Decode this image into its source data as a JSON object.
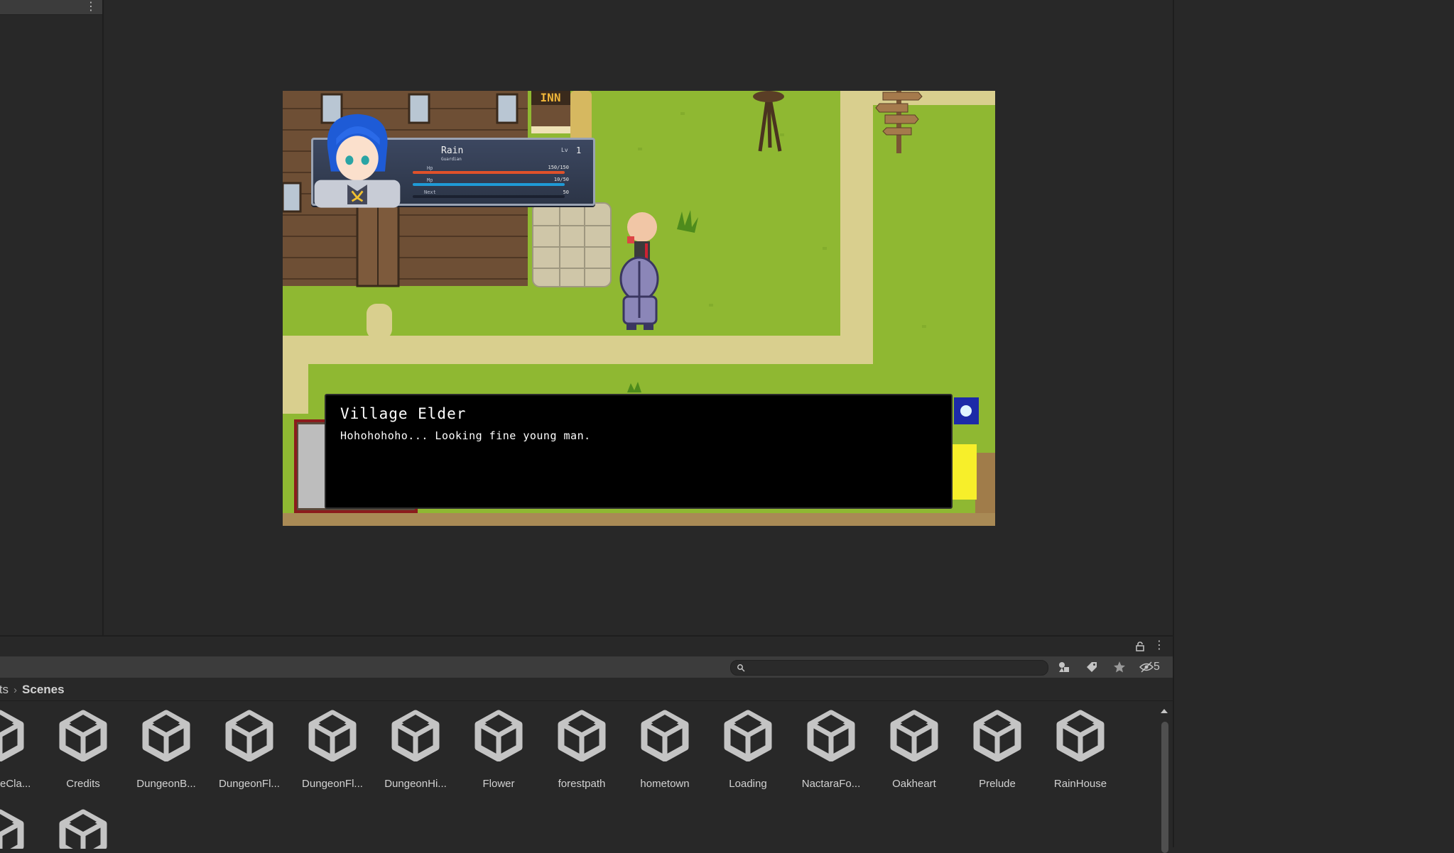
{
  "project": {
    "breadcrumb": [
      "Assets",
      "Scenes"
    ],
    "search_placeholder": "",
    "hidden_count": "5",
    "assets": [
      {
        "label": "ChooseCla..."
      },
      {
        "label": "Credits"
      },
      {
        "label": "DungeonB..."
      },
      {
        "label": "DungeonFl..."
      },
      {
        "label": "DungeonFl..."
      },
      {
        "label": "DungeonHi..."
      },
      {
        "label": "Flower"
      },
      {
        "label": "forestpath"
      },
      {
        "label": "hometown"
      },
      {
        "label": "Loading"
      },
      {
        "label": "NactaraFo..."
      },
      {
        "label": "Oakheart"
      },
      {
        "label": "Prelude"
      },
      {
        "label": "RainHouse"
      },
      {
        "label": ""
      },
      {
        "label": ""
      }
    ]
  },
  "game": {
    "inn_sign": "INN",
    "hud": {
      "name": "Rain",
      "class": "Guardian",
      "level_label": "Lv",
      "level": "1",
      "hp_label": "Hp",
      "hp_value": "150/150",
      "hp_fraction": 1.0,
      "mp_label": "Mp",
      "mp_value": "10/50",
      "mp_fraction": 1.0,
      "next_label": "Next",
      "next_value": "50",
      "next_fraction": 0.0
    },
    "dialog": {
      "speaker": "Village Elder",
      "text": "Hohohohoho... Looking fine young man."
    }
  },
  "colors": {
    "editor_bg": "#282828",
    "toolbar_bg": "#3c3c3c",
    "grass": "#8fb832",
    "path": "#d9cf8e",
    "hp_bar": "#e0512a",
    "mp_bar": "#1f9ad6"
  }
}
